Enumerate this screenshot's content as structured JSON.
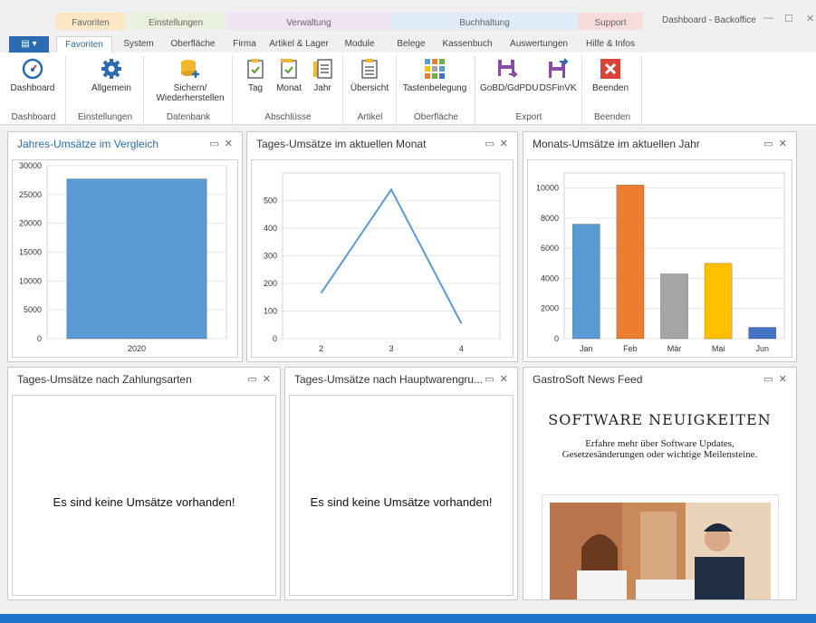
{
  "categories": [
    {
      "label": "Favoriten",
      "color": "#e8a040"
    },
    {
      "label": "Einstellungen",
      "color": "#9ab86c"
    },
    {
      "label": "Verwaltung",
      "color": "#b688c4"
    },
    {
      "label": "Buchhaltung",
      "color": "#6aa4d6"
    },
    {
      "label": "Support",
      "color": "#e07070"
    }
  ],
  "tabs": [
    "Favoriten",
    "System",
    "Oberfläche",
    "Firma",
    "Artikel & Lager",
    "Module",
    "Belege",
    "Kassenbuch",
    "Auswertungen",
    "Hilfe & Infos"
  ],
  "window_title": "Dashboard - Backoffice",
  "ribbon": {
    "buttons": [
      "Dashboard",
      "Allgemein",
      "Sichern/ Wiederherstellen",
      "Tag",
      "Monat",
      "Jahr",
      "Übersicht",
      "Tastenbelegung",
      "GoBD/GdPDU",
      "DSFinVK",
      "Beenden"
    ],
    "groups": [
      "Dashboard",
      "Einstellungen",
      "Datenbank",
      "Abschlüsse",
      "Artikel",
      "Oberfläche",
      "Export",
      "Beenden"
    ]
  },
  "panels": {
    "jahres": "Jahres-Umsätze im Vergleich",
    "tages_monat": "Tages-Umsätze im aktuellen Monat",
    "monats": "Monats-Umsätze im aktuellen Jahr",
    "zahlungsarten": "Tages-Umsätze nach Zahlungsarten",
    "hauptwaren": "Tages-Umsätze nach Hauptwarengru...",
    "news": "GastroSoft News Feed"
  },
  "empty_message": "Es sind keine Umsätze vorhanden!",
  "news": {
    "title": "SOFTWARE NEUIGKEITEN",
    "text": "Erfahre mehr über Software Updates, Gesetzesänderungen oder wichtige Meilensteine."
  },
  "chart_data": [
    {
      "type": "bar",
      "categories": [
        "2020"
      ],
      "values": [
        27700
      ],
      "ylim": [
        0,
        30000
      ],
      "yticks": [
        0,
        5000,
        10000,
        15000,
        20000,
        25000,
        30000
      ],
      "color": "#5b9bd5"
    },
    {
      "type": "line",
      "x": [
        2,
        3,
        4
      ],
      "values": [
        165,
        540,
        55
      ],
      "ylim": [
        0,
        600
      ],
      "yticks": [
        0,
        100,
        200,
        300,
        400,
        500
      ],
      "color": "#5b9bd5"
    },
    {
      "type": "bar",
      "categories": [
        "Jan",
        "Feb",
        "Mär",
        "Mai",
        "Jun"
      ],
      "values": [
        7600,
        10200,
        4300,
        5000,
        750
      ],
      "ylim": [
        0,
        11000
      ],
      "yticks": [
        0,
        2000,
        4000,
        6000,
        8000,
        10000
      ],
      "colors": [
        "#5b9bd5",
        "#ed7d31",
        "#a5a5a5",
        "#ffc000",
        "#4472c4"
      ]
    }
  ]
}
